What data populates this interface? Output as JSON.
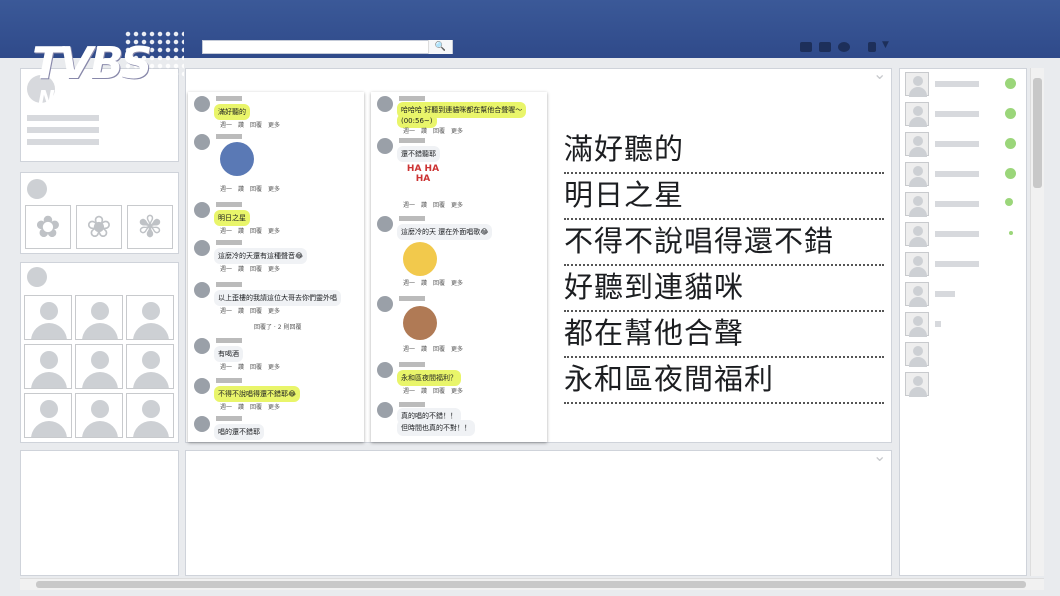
{
  "logo": {
    "main": "TVBS",
    "sub": "NEWS"
  },
  "search": {
    "placeholder": ""
  },
  "subtitles": [
    "滿好聽的",
    "明日之星",
    "不得不說唱得還不錯",
    "好聽到連貓咪",
    "都在幫他合聲",
    "永和區夜間福利"
  ],
  "comment_actions": "週一　讚　回覆　更多",
  "left_phone": {
    "comments": [
      "滿好聽的",
      "",
      "明日之星",
      "這麼冷的天還有這種聲音😂",
      "以上歪樓的我請這位大哥去你們靈外唱",
      "有喝酒",
      "不得不說唱得還不錯耶😂",
      "唱的還不錯耶"
    ],
    "reply_line": "回覆了 · 2 則回覆"
  },
  "right_phone": {
    "comments": [
      "哈哈哈 好聽到連貓咪都在幫他合聲喔～",
      "(00:56~)",
      "還不錯聽耶",
      "HA HA HA",
      "這麼冷的天 還在外面唱歌😂",
      "永和區夜間福利？",
      "真的唱的不錯！！",
      "但時間也真的不對！！"
    ]
  },
  "colors": {
    "topbar": "#3b5998",
    "highlight": "#e9f56a",
    "online": "#9bd67a"
  }
}
